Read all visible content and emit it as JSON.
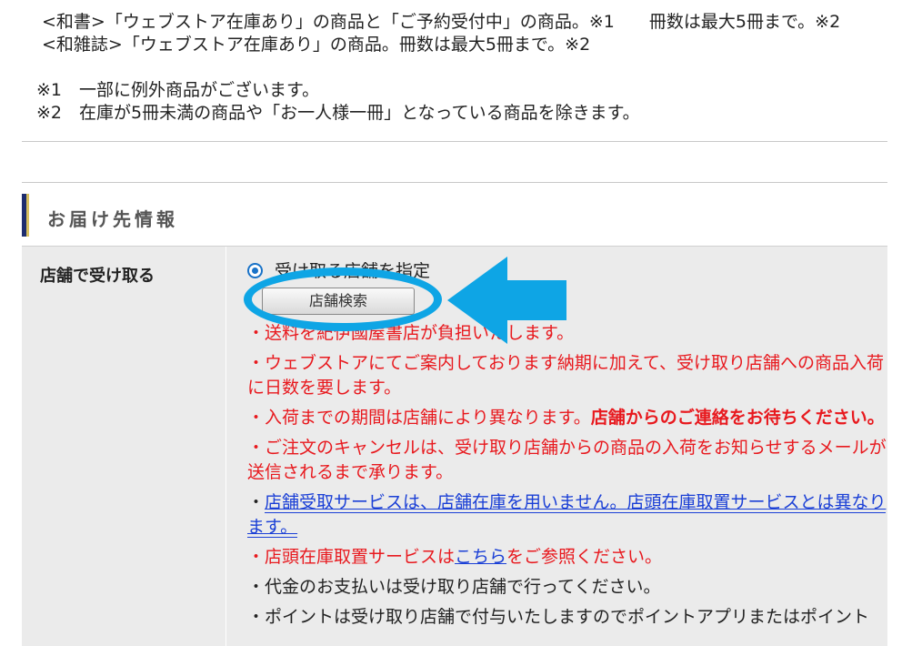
{
  "notes": {
    "line1": "<和書>「ウェブストア在庫あり」の商品と「ご予約受付中」の商品。※1　　冊数は最大5冊まで。※2",
    "line2": "<和雑誌>「ウェブストア在庫あり」の商品。冊数は最大5冊まで。※2",
    "fn1": "※1　一部に例外商品がございます。",
    "fn2": "※2　在庫が5冊未満の商品や「お一人様一冊」となっている商品を除きます。"
  },
  "section": {
    "title": "お届け先情報"
  },
  "store_pickup": {
    "label": "店舗で受け取る",
    "radio_label": "受け取る店舗を指定",
    "search_button": "店舗検索",
    "line_shipping": "・送料を紀伊國屋書店が負担いたします。",
    "line_days": "・ウェブストアにてご案内しております納期に加えて、受け取り店舗への商品入荷に日数を要します。",
    "line_arrival_prefix": "・入荷までの期間は店舗により異なります。",
    "line_arrival_bold": "店舗からのご連絡をお待ちください。",
    "line_cancel": "・ご注文のキャンセルは、受け取り店舗からの商品の入荷をお知らせするメールが送信されるまで承ります。",
    "line_service_prefix": "・",
    "line_service_link": "店舗受取サービスは、店舗在庫を用いません。店頭在庫取置サービスとは異なります。",
    "line_hold_prefix": "・店頭在庫取置サービスは",
    "line_hold_link": "こちら",
    "line_hold_suffix": "をご参照ください。",
    "line_payment": "・代金のお支払いは受け取り店舗で行ってください。",
    "line_points": "・ポイントは受け取り店舗で付与いたしますのでポイントアプリまたはポイント"
  },
  "colors": {
    "annotation": "#0ea5e5",
    "warning_text": "#e8191e",
    "link": "#1a3fd6"
  },
  "annotation_icons": [
    "highlight-ellipse",
    "left-arrow-icon"
  ]
}
